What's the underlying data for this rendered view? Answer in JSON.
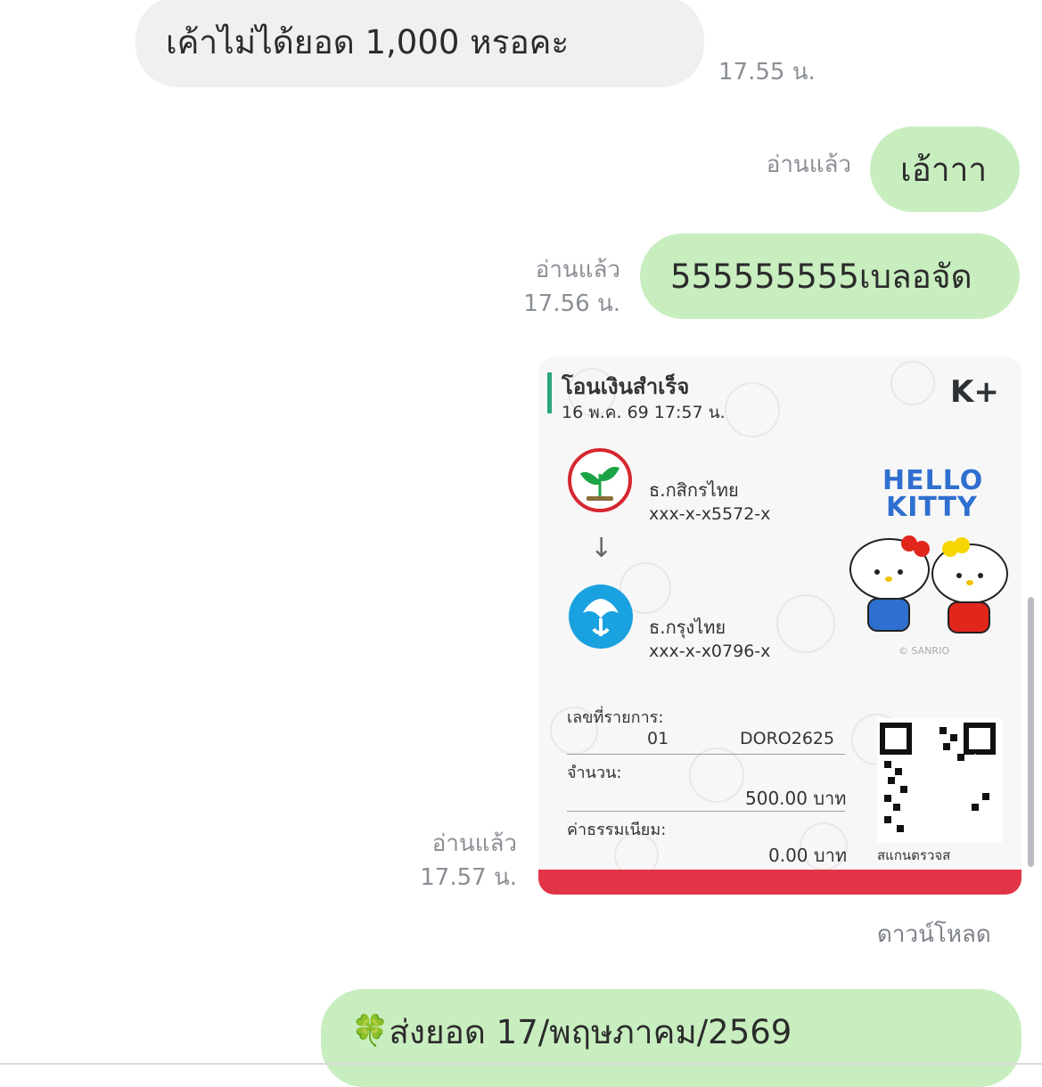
{
  "messages": {
    "m1": {
      "text": "เค้าไม่ได้ยอด 1,000 หรอคะ",
      "time": "17.55 น."
    },
    "m2": {
      "text": "เอ้าาา",
      "read": "อ่านแล้ว"
    },
    "m3": {
      "text": "555555555เบลอจัด",
      "read": "อ่านแล้ว",
      "time": "17.56 น."
    },
    "m4": {
      "read": "อ่านแล้ว",
      "time": "17.57 น.",
      "download": "ดาวน์โหลด"
    },
    "m5": {
      "text": "ส่งยอด 17/พฤษภาคม/2569",
      "emoji": "🍀"
    }
  },
  "receipt": {
    "title": "โอนเงินสำเร็จ",
    "datetime": "16 พ.ค. 69  17:57 น.",
    "brand": "K+",
    "from_bank": "ธ.กสิกรไทย",
    "from_account": "xxx-x-x5572-x",
    "arrow": "↓",
    "to_bank": "ธ.กรุงไทย",
    "to_account": "xxx-x-x0796-x",
    "ref_label": "เลขที่รายการ:",
    "ref_start": "01",
    "ref_end": "DORO2625",
    "amount_label": "จำนวน:",
    "amount": "500.00 บาท",
    "fee_label": "ค่าธรรมเนียม:",
    "fee": "0.00 บาท",
    "qr_caption": "สแกนตรวจส",
    "hello": "HELLO",
    "kitty": "KITTY",
    "copyright": "© SANRIO",
    "colors": {
      "kbank": "#1ba345",
      "ktb": "#1aa1e0",
      "red_strip": "#e23447"
    }
  }
}
